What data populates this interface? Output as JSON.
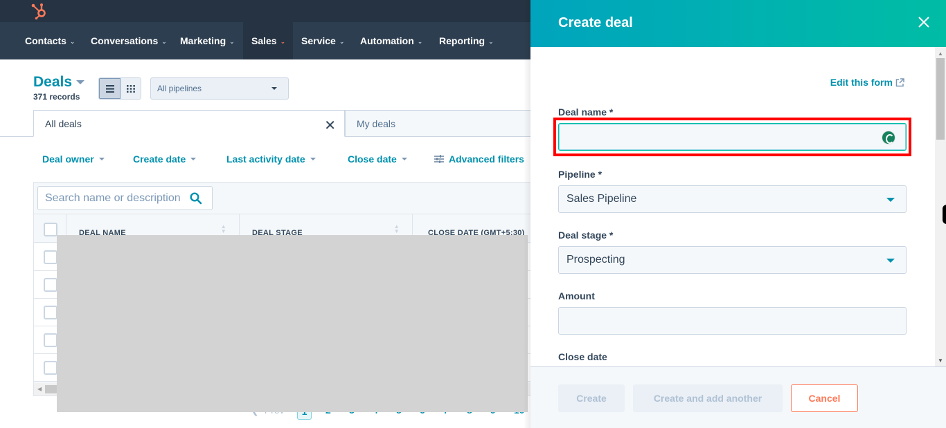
{
  "nav": {
    "items": [
      {
        "label": "Contacts",
        "active": false
      },
      {
        "label": "Conversations",
        "active": false
      },
      {
        "label": "Marketing",
        "active": false
      },
      {
        "label": "Sales",
        "active": true
      },
      {
        "label": "Service",
        "active": false
      },
      {
        "label": "Automation",
        "active": false
      },
      {
        "label": "Reporting",
        "active": false
      }
    ]
  },
  "deals": {
    "title": "Deals",
    "records": "371 records",
    "pipeline_select": "All pipelines",
    "tabs": [
      {
        "label": "All deals",
        "active": true
      },
      {
        "label": "My deals",
        "active": false
      }
    ],
    "filters": [
      "Deal owner",
      "Create date",
      "Last activity date",
      "Close date",
      "Advanced filters"
    ],
    "search_placeholder": "Search name or description",
    "columns": [
      "DEAL NAME",
      "DEAL STAGE",
      "CLOSE DATE (GMT+5:30)"
    ],
    "row_count_visible": 5,
    "pagination": {
      "prev": "Prev",
      "current": "1",
      "pages": [
        "2",
        "3",
        "4",
        "5",
        "6",
        "7",
        "8",
        "9",
        "10"
      ]
    }
  },
  "panel": {
    "title": "Create deal",
    "edit_form_link": "Edit this form",
    "fields": {
      "deal_name": {
        "label": "Deal name *",
        "value": ""
      },
      "pipeline": {
        "label": "Pipeline *",
        "value": "Sales Pipeline"
      },
      "deal_stage": {
        "label": "Deal stage *",
        "value": "Prospecting"
      },
      "amount": {
        "label": "Amount",
        "value": ""
      },
      "close_date": {
        "label": "Close date"
      }
    },
    "buttons": {
      "create": "Create",
      "create_another": "Create and add another",
      "cancel": "Cancel"
    }
  },
  "colors": {
    "brand_orange": "#ff7a59",
    "accent_teal": "#0091ae",
    "header_gradient_start": "#00a4bd",
    "header_gradient_end": "#00bda5",
    "nav_bg": "#2d3e50",
    "highlight_red": "#ff0000"
  }
}
